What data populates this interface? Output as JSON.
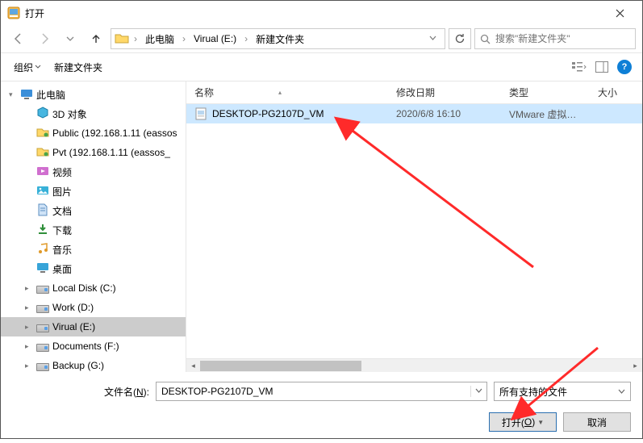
{
  "window": {
    "title": "打开"
  },
  "breadcrumbs": {
    "items": [
      {
        "label": "此电脑"
      },
      {
        "label": "Virual (E:)"
      },
      {
        "label": "新建文件夹"
      }
    ]
  },
  "search": {
    "placeholder": "搜索\"新建文件夹\""
  },
  "toolbar": {
    "organize": "组织",
    "new_folder": "新建文件夹"
  },
  "columns": {
    "name": "名称",
    "modified": "修改日期",
    "type": "类型",
    "size": "大小"
  },
  "sidebar": {
    "root": "此电脑",
    "items": [
      {
        "label": "3D 对象",
        "icon": "3d"
      },
      {
        "label": "Public (192.168.1.11 (eassos",
        "icon": "netfolder"
      },
      {
        "label": "Pvt (192.168.1.11 (eassos_",
        "icon": "netfolder"
      },
      {
        "label": "视频",
        "icon": "video"
      },
      {
        "label": "图片",
        "icon": "pictures"
      },
      {
        "label": "文档",
        "icon": "docs"
      },
      {
        "label": "下载",
        "icon": "downloads"
      },
      {
        "label": "音乐",
        "icon": "music"
      },
      {
        "label": "桌面",
        "icon": "desktop"
      },
      {
        "label": "Local Disk (C:)",
        "icon": "disk"
      },
      {
        "label": "Work (D:)",
        "icon": "disk"
      },
      {
        "label": "Virual (E:)",
        "icon": "disk",
        "selected": true
      },
      {
        "label": "Documents (F:)",
        "icon": "disk"
      },
      {
        "label": "Backup (G:)",
        "icon": "disk"
      }
    ]
  },
  "files": {
    "rows": [
      {
        "name": "DESKTOP-PG2107D_VM",
        "date": "2020/6/8 16:10",
        "type": "VMware 虚拟机...",
        "selected": true
      }
    ]
  },
  "footer": {
    "filename_label": "文件名(",
    "filename_key": "N",
    "filename_label_after": "):",
    "filename_value": "DESKTOP-PG2107D_VM",
    "filetype": "所有支持的文件",
    "open": "打开(",
    "open_key": "O",
    "open_after": ")",
    "cancel": "取消"
  }
}
